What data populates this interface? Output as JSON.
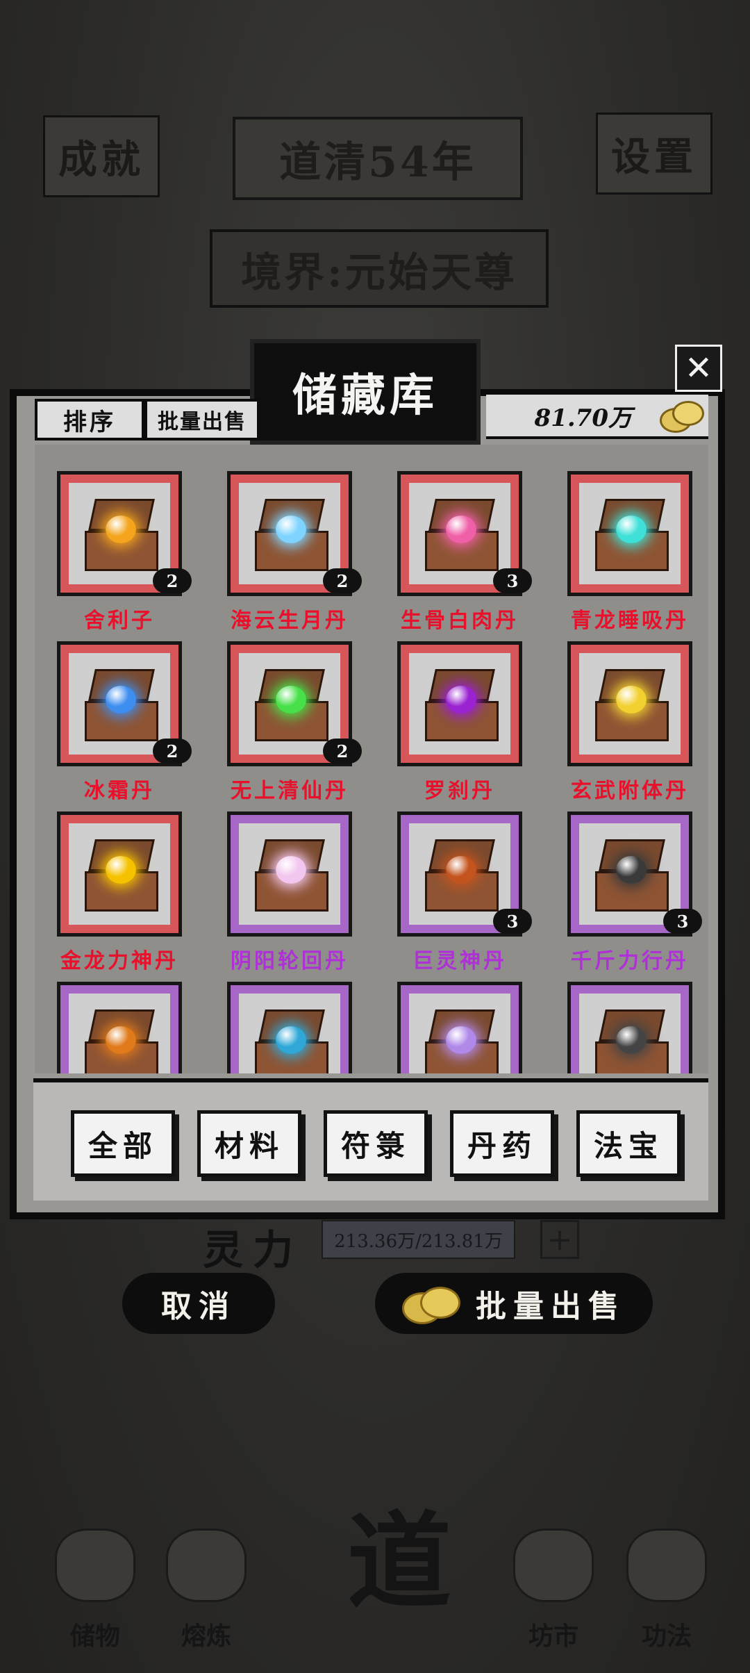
{
  "background": {
    "top_left_button": "成就",
    "top_right_button": "设置",
    "year_banner": "道清54年",
    "realm_banner": "境界:元始天尊",
    "spirit_label": "灵力",
    "spirit_value": "213.36万/213.81万",
    "cancel_button": "取消",
    "bulk_sell_button": "批量出售"
  },
  "bottom_nav": {
    "items": [
      "储物",
      "熔炼",
      "坊市",
      "功法"
    ],
    "center": "道"
  },
  "storage": {
    "title": "储藏库",
    "sort_tab": "排序",
    "bulk_sell_tab": "批量出售",
    "money": "81.70万"
  },
  "items": [
    {
      "name": "舍利子",
      "count": "2",
      "rarity": "red",
      "orb": "#f4a51d"
    },
    {
      "name": "海云生月丹",
      "count": "2",
      "rarity": "red",
      "orb": "#7fd4ff"
    },
    {
      "name": "生骨白肉丹",
      "count": "3",
      "rarity": "red",
      "orb": "#f060a8"
    },
    {
      "name": "青龙睡吸丹",
      "count": "",
      "rarity": "red",
      "orb": "#3fe0d8"
    },
    {
      "name": "冰霜丹",
      "count": "2",
      "rarity": "red",
      "orb": "#3e8ef0"
    },
    {
      "name": "无上清仙丹",
      "count": "2",
      "rarity": "red",
      "orb": "#48e048"
    },
    {
      "name": "罗刹丹",
      "count": "",
      "rarity": "red",
      "orb": "#9a22d0"
    },
    {
      "name": "玄武附体丹",
      "count": "",
      "rarity": "red",
      "orb": "#f2d030"
    },
    {
      "name": "金龙力神丹",
      "count": "",
      "rarity": "red",
      "orb": "#f6c200"
    },
    {
      "name": "阴阳轮回丹",
      "count": "",
      "rarity": "purple",
      "orb": "#f2c6ee"
    },
    {
      "name": "巨灵神丹",
      "count": "3",
      "rarity": "purple",
      "orb": "#c4541e"
    },
    {
      "name": "千斤力行丹",
      "count": "3",
      "rarity": "purple",
      "orb": "#3a3a3a"
    },
    {
      "name": "",
      "count": "",
      "rarity": "purple",
      "orb": "#e07a1a"
    },
    {
      "name": "",
      "count": "",
      "rarity": "purple",
      "orb": "#2fa8d8"
    },
    {
      "name": "",
      "count": "",
      "rarity": "purple",
      "orb": "#b088e8"
    },
    {
      "name": "",
      "count": "",
      "rarity": "purple",
      "orb": "#444444"
    }
  ],
  "filters": [
    "全部",
    "材料",
    "符箓",
    "丹药",
    "法宝"
  ]
}
